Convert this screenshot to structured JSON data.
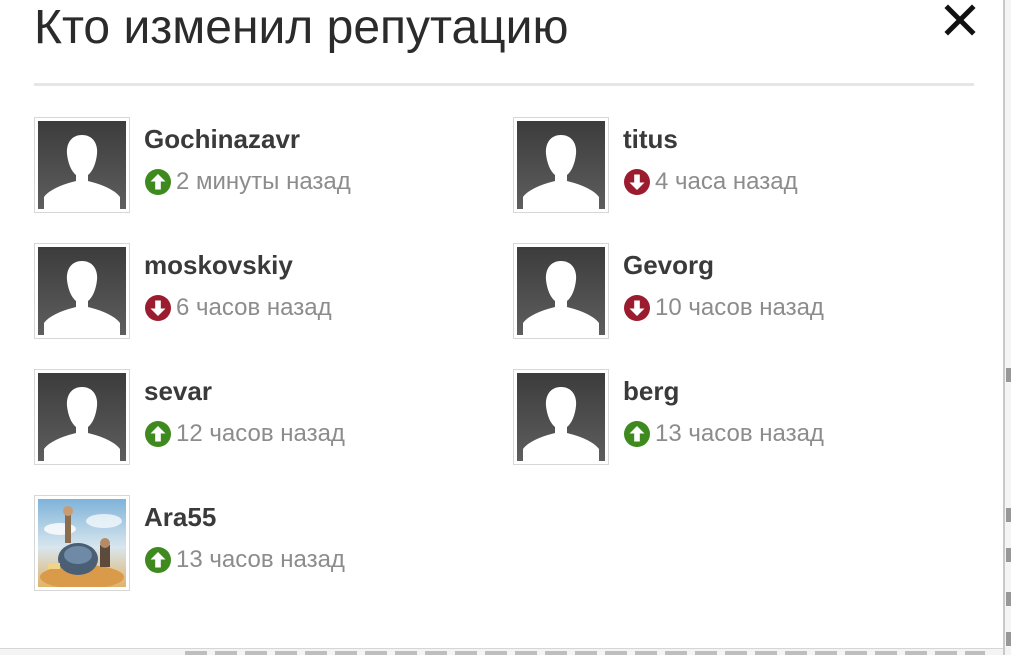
{
  "modal": {
    "title": "Кто изменил репутацию",
    "close_icon": "close-x-icon"
  },
  "colors": {
    "up": "#3f8a1f",
    "down": "#9b1c2e",
    "title": "#2b2b2b",
    "username": "#3a3a3a",
    "time": "#8c8c8c"
  },
  "voters": [
    {
      "username": "Gochinazavr",
      "vote": "up",
      "vote_icon": "arrow-up-circle-icon",
      "time": "2 минуты назад",
      "avatar": "default-silhouette"
    },
    {
      "username": "titus",
      "vote": "down",
      "vote_icon": "arrow-down-circle-icon",
      "time": "4 часа назад",
      "avatar": "default-silhouette"
    },
    {
      "username": "moskovskiy",
      "vote": "down",
      "vote_icon": "arrow-down-circle-icon",
      "time": "6 часов назад",
      "avatar": "default-silhouette"
    },
    {
      "username": "Gevorg",
      "vote": "down",
      "vote_icon": "arrow-down-circle-icon",
      "time": "10 часов назад",
      "avatar": "default-silhouette"
    },
    {
      "username": "sevar",
      "vote": "up",
      "vote_icon": "arrow-up-circle-icon",
      "time": "12 часов назад",
      "avatar": "default-silhouette"
    },
    {
      "username": "berg",
      "vote": "up",
      "vote_icon": "arrow-up-circle-icon",
      "time": "13 часов назад",
      "avatar": "default-silhouette"
    },
    {
      "username": "Ara55",
      "vote": "up",
      "vote_icon": "arrow-up-circle-icon",
      "time": "13 часов назад",
      "avatar": "custom-picture"
    }
  ]
}
